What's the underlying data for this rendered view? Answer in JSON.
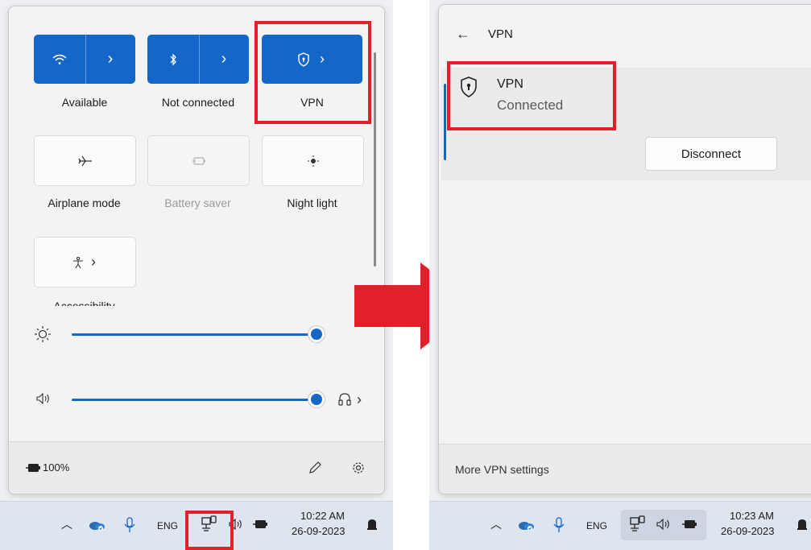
{
  "left": {
    "tiles": {
      "wifi": {
        "label": "Available"
      },
      "bluetooth": {
        "label": "Not connected"
      },
      "vpn": {
        "label": "VPN"
      },
      "airplane": {
        "label": "Airplane mode"
      },
      "battery_saver": {
        "label": "Battery saver"
      },
      "night_light": {
        "label": "Night light"
      },
      "accessibility": {
        "label": "Accessibility"
      }
    },
    "brightness_level": 1.0,
    "volume_level": 1.0,
    "battery_text": "100%",
    "taskbar": {
      "lang": "ENG",
      "time": "10:22 AM",
      "date": "26-09-2023"
    }
  },
  "right": {
    "header_title": "VPN",
    "vpn_name": "VPN",
    "vpn_status": "Connected",
    "disconnect_label": "Disconnect",
    "more_settings_label": "More VPN settings",
    "taskbar": {
      "lang": "ENG",
      "time": "10:23 AM",
      "date": "26-09-2023"
    }
  },
  "colors": {
    "accent": "#1467c9",
    "highlight": "#e3202a"
  }
}
